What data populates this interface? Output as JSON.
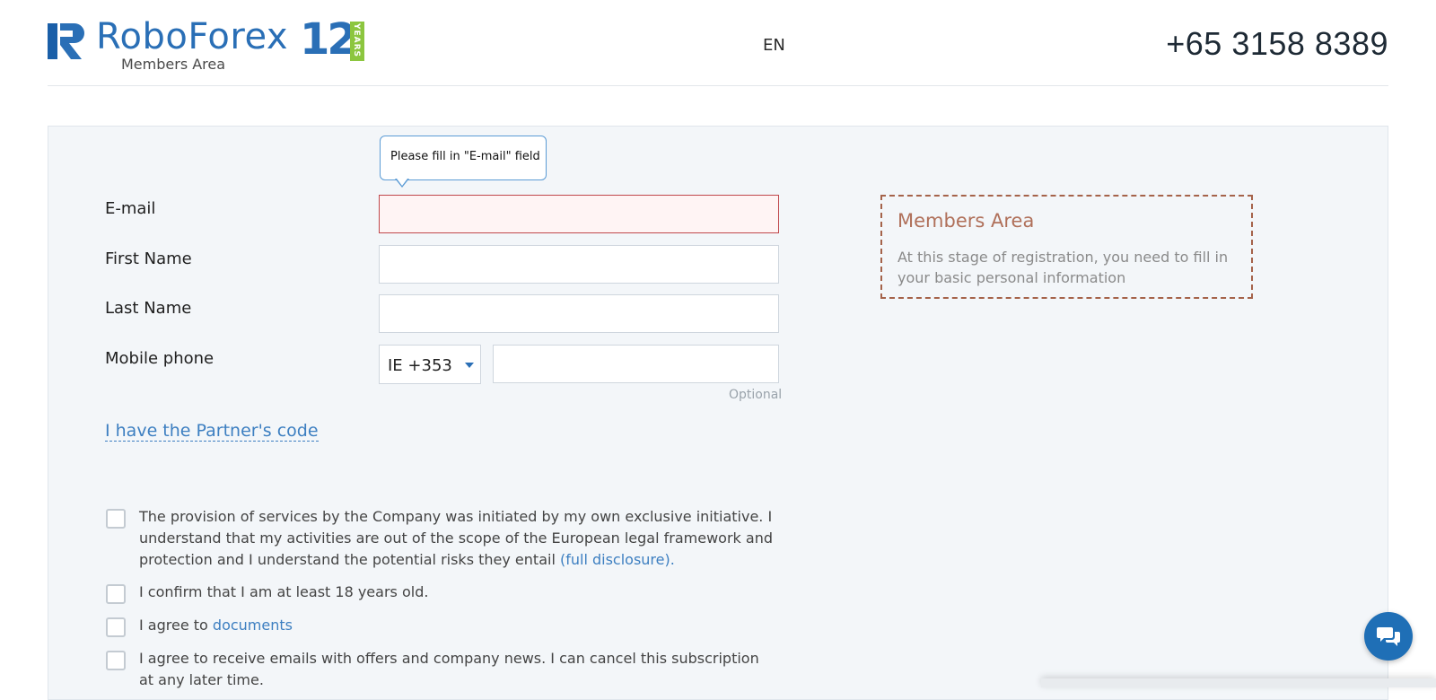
{
  "header": {
    "brand": "RoboForex",
    "brand_years_number": "12",
    "brand_years_label": "YEARS",
    "brand_subtitle": "Members Area",
    "language": "EN",
    "phone": "+65 3158 8389"
  },
  "tooltip": "Please fill in \"E-mail\" field",
  "form": {
    "email_label": "E-mail",
    "first_name_label": "First Name",
    "last_name_label": "Last Name",
    "mobile_label": "Mobile phone",
    "phone_code": "IE +353",
    "optional_hint": "Optional",
    "partner_link": "I have the Partner's code"
  },
  "info": {
    "title": "Members Area",
    "text": "At this stage of registration, you need to fill in your basic personal information"
  },
  "checkboxes": [
    {
      "text": "The provision of services by the Company was initiated by my own exclusive initiative. I understand that my activities are out of the scope of the European legal framework and protection and I understand the potential risks they entail",
      "link": "(full disclosure)."
    },
    {
      "text": "I confirm that I am at least 18 years old."
    },
    {
      "text": "I agree to",
      "link": "documents"
    },
    {
      "text": "I agree to receive emails with offers and company news. I can cancel this subscription at any later time."
    }
  ],
  "colors": {
    "brand_blue": "#2a6fb6",
    "years_green": "#8cc63f",
    "error_border": "#c0484c",
    "info_border": "#a5634a",
    "link": "#3d7fc1"
  },
  "icons": {
    "logo": "roboforex-logo-icon",
    "chat": "chat-bubbles-icon",
    "dropdown": "caret-down-icon"
  }
}
